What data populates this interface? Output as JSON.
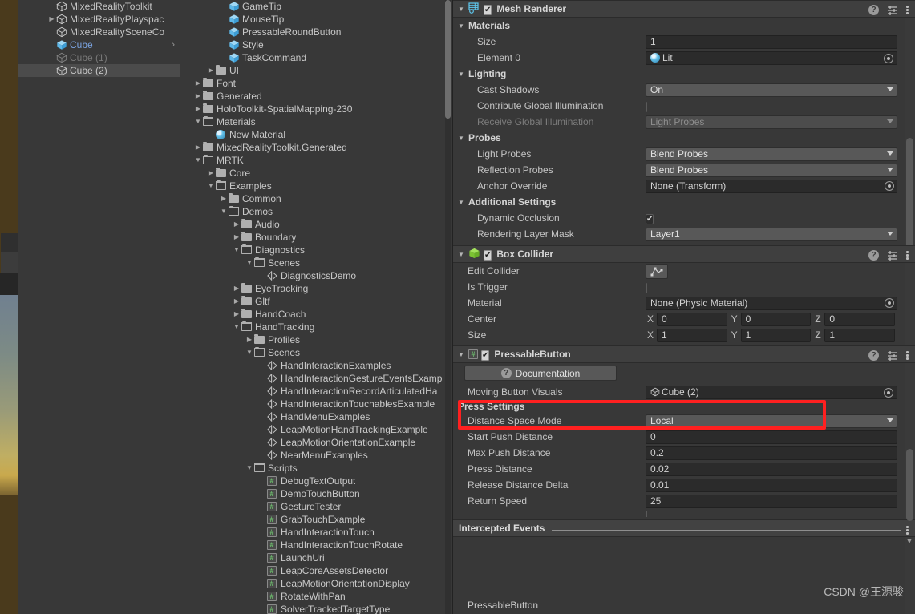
{
  "app": {
    "name": "Unity Editor",
    "watermark": "CSDN @王源骏"
  },
  "hierarchy": {
    "items": [
      {
        "label": "MixedRealityToolkit",
        "indent": 1,
        "arrow": false,
        "state": "normal",
        "icon": "gameobject-icon",
        "chevron": false
      },
      {
        "label": "MixedRealityPlayspac",
        "indent": 1,
        "arrow": true,
        "state": "normal",
        "icon": "gameobject-icon",
        "chevron": false
      },
      {
        "label": "MixedRealitySceneCo",
        "indent": 1,
        "arrow": false,
        "state": "normal",
        "icon": "gameobject-icon",
        "chevron": false
      },
      {
        "label": "Cube",
        "indent": 1,
        "arrow": false,
        "state": "prefab",
        "icon": "prefab-cube-icon",
        "chevron": true
      },
      {
        "label": "Cube (1)",
        "indent": 1,
        "arrow": false,
        "state": "disabled",
        "icon": "gameobject-icon",
        "chevron": false
      },
      {
        "label": "Cube (2)",
        "indent": 1,
        "arrow": false,
        "state": "selected",
        "icon": "gameobject-icon",
        "chevron": false
      }
    ]
  },
  "project": {
    "items": [
      {
        "label": "GameTip",
        "indent": 4,
        "arrow": "none",
        "icon": "prefab-cube-icon"
      },
      {
        "label": "MouseTip",
        "indent": 4,
        "arrow": "none",
        "icon": "prefab-cube-icon"
      },
      {
        "label": "PressableRoundButton",
        "indent": 4,
        "arrow": "none",
        "icon": "prefab-cube-icon"
      },
      {
        "label": "Style",
        "indent": 4,
        "arrow": "none",
        "icon": "prefab-cube-icon"
      },
      {
        "label": "TaskCommand",
        "indent": 4,
        "arrow": "none",
        "icon": "prefab-cube-icon"
      },
      {
        "label": "UI",
        "indent": 3,
        "arrow": "right",
        "icon": "folder-icon"
      },
      {
        "label": "Font",
        "indent": 2,
        "arrow": "right",
        "icon": "folder-icon"
      },
      {
        "label": "Generated",
        "indent": 2,
        "arrow": "right",
        "icon": "folder-icon"
      },
      {
        "label": "HoloToolkit-SpatialMapping-230",
        "indent": 2,
        "arrow": "right",
        "icon": "folder-icon"
      },
      {
        "label": "Materials",
        "indent": 2,
        "arrow": "down",
        "icon": "folder-open-icon"
      },
      {
        "label": "New Material",
        "indent": 3,
        "arrow": "none",
        "icon": "material-icon"
      },
      {
        "label": "MixedRealityToolkit.Generated",
        "indent": 2,
        "arrow": "right",
        "icon": "folder-icon"
      },
      {
        "label": "MRTK",
        "indent": 2,
        "arrow": "down",
        "icon": "folder-open-icon"
      },
      {
        "label": "Core",
        "indent": 3,
        "arrow": "right",
        "icon": "folder-icon"
      },
      {
        "label": "Examples",
        "indent": 3,
        "arrow": "down",
        "icon": "folder-open-icon"
      },
      {
        "label": "Common",
        "indent": 4,
        "arrow": "right",
        "icon": "folder-icon"
      },
      {
        "label": "Demos",
        "indent": 4,
        "arrow": "down",
        "icon": "folder-open-icon"
      },
      {
        "label": "Audio",
        "indent": 5,
        "arrow": "right",
        "icon": "folder-icon"
      },
      {
        "label": "Boundary",
        "indent": 5,
        "arrow": "right",
        "icon": "folder-icon"
      },
      {
        "label": "Diagnostics",
        "indent": 5,
        "arrow": "down",
        "icon": "folder-open-icon"
      },
      {
        "label": "Scenes",
        "indent": 6,
        "arrow": "down",
        "icon": "folder-open-icon"
      },
      {
        "label": "DiagnosticsDemo",
        "indent": 7,
        "arrow": "none",
        "icon": "scene-icon"
      },
      {
        "label": "EyeTracking",
        "indent": 5,
        "arrow": "right",
        "icon": "folder-icon"
      },
      {
        "label": "Gltf",
        "indent": 5,
        "arrow": "right",
        "icon": "folder-icon"
      },
      {
        "label": "HandCoach",
        "indent": 5,
        "arrow": "right",
        "icon": "folder-icon"
      },
      {
        "label": "HandTracking",
        "indent": 5,
        "arrow": "down",
        "icon": "folder-open-icon"
      },
      {
        "label": "Profiles",
        "indent": 6,
        "arrow": "right",
        "icon": "folder-icon"
      },
      {
        "label": "Scenes",
        "indent": 6,
        "arrow": "down",
        "icon": "folder-open-icon"
      },
      {
        "label": "HandInteractionExamples",
        "indent": 7,
        "arrow": "none",
        "icon": "scene-icon"
      },
      {
        "label": "HandInteractionGestureEventsExamp",
        "indent": 7,
        "arrow": "none",
        "icon": "scene-icon"
      },
      {
        "label": "HandInteractionRecordArticulatedHa",
        "indent": 7,
        "arrow": "none",
        "icon": "scene-icon"
      },
      {
        "label": "HandInteractionTouchablesExample",
        "indent": 7,
        "arrow": "none",
        "icon": "scene-icon"
      },
      {
        "label": "HandMenuExamples",
        "indent": 7,
        "arrow": "none",
        "icon": "scene-icon"
      },
      {
        "label": "LeapMotionHandTrackingExample",
        "indent": 7,
        "arrow": "none",
        "icon": "scene-icon"
      },
      {
        "label": "LeapMotionOrientationExample",
        "indent": 7,
        "arrow": "none",
        "icon": "scene-icon"
      },
      {
        "label": "NearMenuExamples",
        "indent": 7,
        "arrow": "none",
        "icon": "scene-icon"
      },
      {
        "label": "Scripts",
        "indent": 6,
        "arrow": "down",
        "icon": "folder-open-icon"
      },
      {
        "label": "DebugTextOutput",
        "indent": 7,
        "arrow": "none",
        "icon": "script-icon"
      },
      {
        "label": "DemoTouchButton",
        "indent": 7,
        "arrow": "none",
        "icon": "script-icon"
      },
      {
        "label": "GestureTester",
        "indent": 7,
        "arrow": "none",
        "icon": "script-icon"
      },
      {
        "label": "GrabTouchExample",
        "indent": 7,
        "arrow": "none",
        "icon": "script-icon"
      },
      {
        "label": "HandInteractionTouch",
        "indent": 7,
        "arrow": "none",
        "icon": "script-icon"
      },
      {
        "label": "HandInteractionTouchRotate",
        "indent": 7,
        "arrow": "none",
        "icon": "script-icon"
      },
      {
        "label": "LaunchUri",
        "indent": 7,
        "arrow": "none",
        "icon": "script-icon"
      },
      {
        "label": "LeapCoreAssetsDetector",
        "indent": 7,
        "arrow": "none",
        "icon": "script-icon"
      },
      {
        "label": "LeapMotionOrientationDisplay",
        "indent": 7,
        "arrow": "none",
        "icon": "script-icon"
      },
      {
        "label": "RotateWithPan",
        "indent": 7,
        "arrow": "none",
        "icon": "script-icon"
      },
      {
        "label": "SolverTrackedTargetType",
        "indent": 7,
        "arrow": "none",
        "icon": "script-icon"
      }
    ]
  },
  "inspector": {
    "mesh_renderer": {
      "title": "Mesh Renderer",
      "enabled": true,
      "materials_label": "Materials",
      "size_label": "Size",
      "size_value": "1",
      "element0_label": "Element 0",
      "element0_value": "Lit",
      "lighting_label": "Lighting",
      "cast_shadows_label": "Cast Shadows",
      "cast_shadows_value": "On",
      "contribute_gi_label": "Contribute Global Illumination",
      "contribute_gi_checked": false,
      "receive_gi_label": "Receive Global Illumination",
      "receive_gi_value": "Light Probes",
      "probes_label": "Probes",
      "light_probes_label": "Light Probes",
      "light_probes_value": "Blend Probes",
      "reflection_probes_label": "Reflection Probes",
      "reflection_probes_value": "Blend Probes",
      "anchor_override_label": "Anchor Override",
      "anchor_override_value": "None (Transform)",
      "additional_settings_label": "Additional Settings",
      "dynamic_occlusion_label": "Dynamic Occlusion",
      "dynamic_occlusion_checked": true,
      "rendering_layer_mask_label": "Rendering Layer Mask",
      "rendering_layer_mask_value": "Layer1"
    },
    "box_collider": {
      "title": "Box Collider",
      "enabled": true,
      "edit_collider_label": "Edit Collider",
      "is_trigger_label": "Is Trigger",
      "is_trigger_checked": false,
      "material_label": "Material",
      "material_value": "None (Physic Material)",
      "center_label": "Center",
      "center": {
        "x": "0",
        "y": "0",
        "z": "0"
      },
      "size_label": "Size",
      "size": {
        "x": "1",
        "y": "1",
        "z": "1"
      },
      "axis_labels": {
        "x": "X",
        "y": "Y",
        "z": "Z"
      }
    },
    "pressable_button": {
      "title": "PressableButton",
      "enabled": true,
      "documentation_label": "Documentation",
      "moving_button_visuals_label": "Moving Button Visuals",
      "moving_button_visuals_value": "Cube (2)",
      "press_settings_label": "Press Settings",
      "distance_space_mode_label": "Distance Space Mode",
      "distance_space_mode_value": "Local",
      "start_push_distance_label": "Start Push Distance",
      "start_push_distance_value": "0",
      "max_push_distance_label": "Max Push Distance",
      "max_push_distance_value": "0.2",
      "press_distance_label": "Press Distance",
      "press_distance_value": "0.02",
      "release_distance_delta_label": "Release Distance Delta",
      "release_distance_delta_value": "0.01",
      "return_speed_label": "Return Speed",
      "return_speed_value": "25"
    },
    "intercepted_events_label": "Intercepted Events",
    "footer_component_label": "PressableButton"
  },
  "colors": {
    "panel_bg": "#383838",
    "header_bg": "#3f3f3f",
    "field_bg": "#2b2b2b",
    "dropdown_bg": "#585858",
    "selection": "#4b4b4b",
    "prefab_blue": "#7aa3e0",
    "highlight_red": "#ff2020",
    "collider_green": "#8cd64a"
  }
}
